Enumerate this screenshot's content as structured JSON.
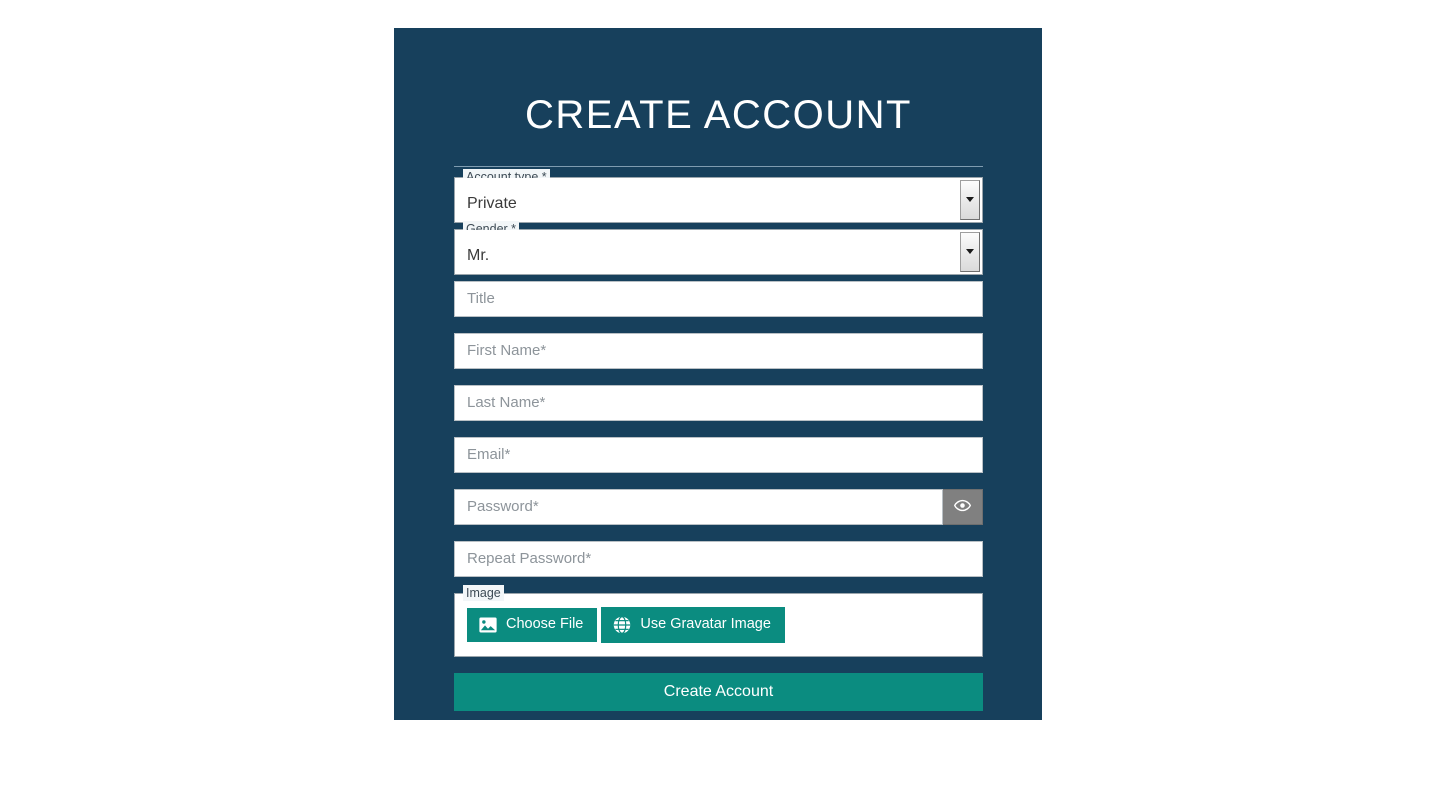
{
  "theme": {
    "panel_bg": "#17405c",
    "page_bg": "#ffffff",
    "accent_teal": "#0b8c80",
    "title_color": "#ffffff",
    "placeholder_color": "#8d949a",
    "toggle_button_bg": "#808080"
  },
  "header": {
    "title": "CREATE ACCOUNT"
  },
  "form": {
    "account_type": {
      "legend": "Account type *",
      "selected": "Private",
      "arrow_icon": "chevron-down-icon"
    },
    "gender": {
      "legend": "Gender *",
      "selected": "Mr.",
      "arrow_icon": "chevron-down-icon"
    },
    "title_field": {
      "placeholder": "Title",
      "value": ""
    },
    "first_name": {
      "placeholder": "First Name*",
      "value": ""
    },
    "last_name": {
      "placeholder": "Last Name*",
      "value": ""
    },
    "email": {
      "placeholder": "Email*",
      "value": ""
    },
    "password": {
      "placeholder": "Password*",
      "value": "",
      "toggle_icon": "eye-icon"
    },
    "repeat_password": {
      "placeholder": "Repeat Password*",
      "value": ""
    },
    "image": {
      "legend": "Image",
      "choose_file": {
        "label": "Choose File",
        "icon": "image-icon"
      },
      "gravatar": {
        "label": "Use Gravatar Image",
        "icon": "globe-icon"
      }
    },
    "submit": {
      "label": "Create Account"
    }
  }
}
